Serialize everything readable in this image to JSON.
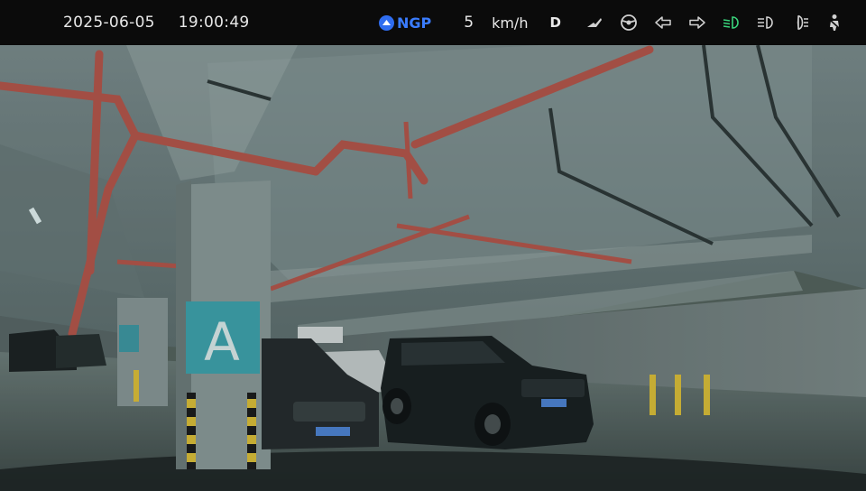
{
  "status": {
    "date": "2025-06-05",
    "time": "19:00:49",
    "ngp_label": "NGP",
    "speed": "5",
    "speed_unit": "km/h",
    "gear": "D"
  },
  "icons": [
    "road-sign-icon",
    "steering-wheel-icon",
    "turn-left-icon",
    "turn-right-icon",
    "low-beam-icon",
    "high-beam-icon",
    "fog-light-icon",
    "seatbelt-icon"
  ],
  "colors": {
    "ngp": "#3a7cff",
    "low_beam_active": "#39d27a",
    "indicator": "#d0d0d0"
  },
  "scene": {
    "pillar_letter": "A"
  }
}
